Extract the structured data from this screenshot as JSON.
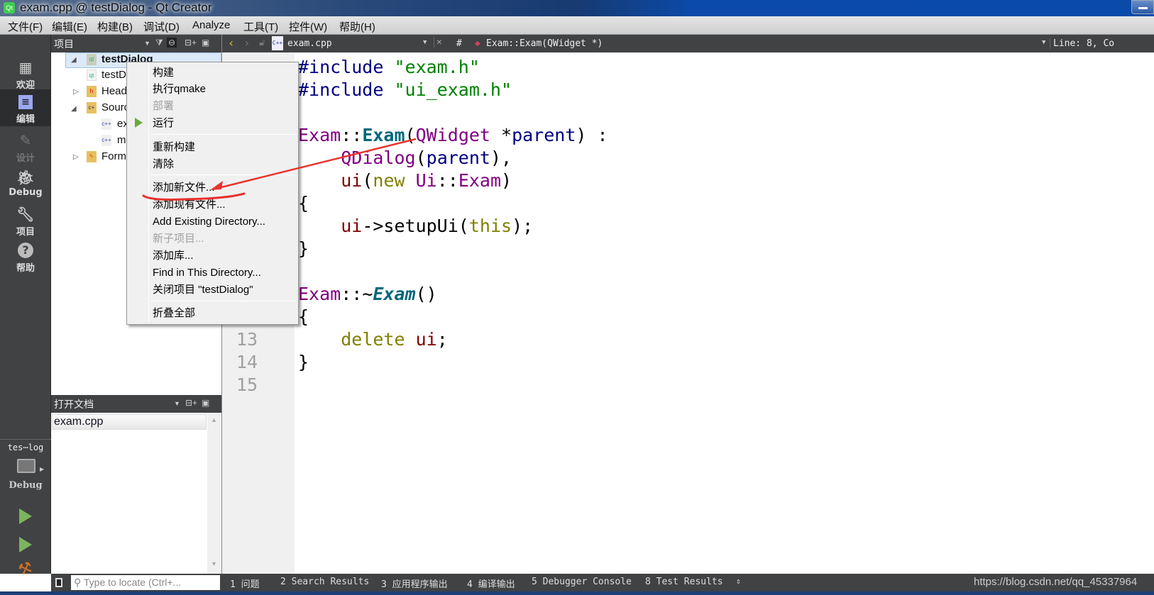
{
  "window": {
    "title": "exam.cpp @ testDialog - Qt Creator",
    "app_icon": "Qt"
  },
  "menubar": [
    "文件(F)",
    "编辑(E)",
    "构建(B)",
    "调试(D)",
    "Analyze",
    "工具(T)",
    "控件(W)",
    "帮助(H)"
  ],
  "modes": [
    {
      "label": "欢迎",
      "icon": "grid-icon"
    },
    {
      "label": "编辑",
      "icon": "edit-document-icon",
      "active": true
    },
    {
      "label": "设计",
      "icon": "pencil-icon",
      "disabled": true
    },
    {
      "label": "Debug",
      "icon": "bug-icon"
    },
    {
      "label": "项目",
      "icon": "wrench-icon"
    },
    {
      "label": "帮助",
      "icon": "help-icon"
    }
  ],
  "kit": {
    "project": "tes⋯log",
    "build": "Debug"
  },
  "project_pane": {
    "title": "项目",
    "tree": [
      {
        "label": "testDialog",
        "level": 0,
        "expanded": true,
        "selected": true
      },
      {
        "label": "testDialog.pro",
        "level": 1
      },
      {
        "label": "Headers",
        "level": 1,
        "expanded": false
      },
      {
        "label": "Sources",
        "level": 1,
        "expanded": true
      },
      {
        "label": "exam.cpp",
        "level": 2
      },
      {
        "label": "main.cpp",
        "level": 2
      },
      {
        "label": "Forms",
        "level": 1,
        "expanded": false
      }
    ]
  },
  "open_docs": {
    "title": "打开文档",
    "items": [
      "exam.cpp"
    ]
  },
  "editor": {
    "file": "exam.cpp",
    "symbol": "Exam::Exam(QWidget *)",
    "position": "Line: 8, Co",
    "hash": "#",
    "line_numbers": [
      "13",
      "14",
      "15"
    ],
    "lines": [
      "#include \"exam.h\"",
      "#include \"ui_exam.h\"",
      "",
      "Exam::Exam(QWidget *parent) :",
      "    QDialog(parent),",
      "    ui(new Ui::Exam)",
      "{",
      "    ui->setupUi(this);",
      "}",
      "",
      "Exam::~Exam()",
      "{",
      "    delete ui;",
      "}",
      ""
    ]
  },
  "context_menu": [
    {
      "label": "构建"
    },
    {
      "label": "执行qmake"
    },
    {
      "label": "部署",
      "disabled": true
    },
    {
      "label": "运行",
      "icon": "run-icon"
    },
    {
      "label": "重新构建"
    },
    {
      "label": "清除"
    },
    {
      "label": "添加新文件...",
      "annotated": true
    },
    {
      "label": "添加现有文件..."
    },
    {
      "label": "Add Existing Directory..."
    },
    {
      "label": "新子项目...",
      "disabled": true
    },
    {
      "label": "添加库..."
    },
    {
      "label": "Find in This Directory..."
    },
    {
      "label": "关闭项目 \"testDialog\""
    },
    {
      "label": "折叠全部"
    }
  ],
  "statusbar": {
    "locate_placeholder": "Type to locate (Ctrl+...",
    "panes": [
      "1 问题",
      "2 Search Results",
      "3 应用程序输出",
      "4 编译输出",
      "5 Debugger Console",
      "8 Test Results"
    ],
    "watermark": "https://blog.csdn.net/qq_45337964"
  },
  "colors": {
    "annotation": "#e8322e",
    "sidebar": "#404244",
    "keyword": "#808000",
    "type": "#800080",
    "string": "#008000"
  }
}
